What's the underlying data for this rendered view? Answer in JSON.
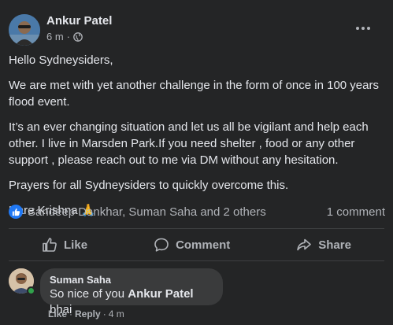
{
  "post": {
    "author": "Ankur Patel",
    "time": "6 m",
    "separator": "·",
    "paragraphs": [
      "Hello Sydneysiders,",
      "We are met with yet another challenge in the form of once in 100 years flood event.",
      "It’s an ever changing situation and let us all be vigilant and help each other. I live in Marsden Park.If you need shelter , food or any other support , please reach out to me via DM without any hesitation.",
      "Prayers for all Sydneysiders to quickly overcome this.",
      "Hare Krishna 🙏"
    ]
  },
  "reactions": {
    "names": "Sandeep Dankhar, Suman Saha and 2 others",
    "comments": "1 comment"
  },
  "actions": {
    "like": "Like",
    "comment": "Comment",
    "share": "Share"
  },
  "comment": {
    "name": "Suman Saha",
    "text_before": "So nice of you ",
    "mention": "Ankur Patel",
    "text_after": " bhai",
    "like": "Like",
    "sep": "·",
    "reply": "Reply",
    "time": "4 m"
  },
  "colors": {
    "background": "#242526",
    "like_blue": "#2078f4",
    "bubble": "#3a3b3c",
    "online": "#31a24c"
  }
}
